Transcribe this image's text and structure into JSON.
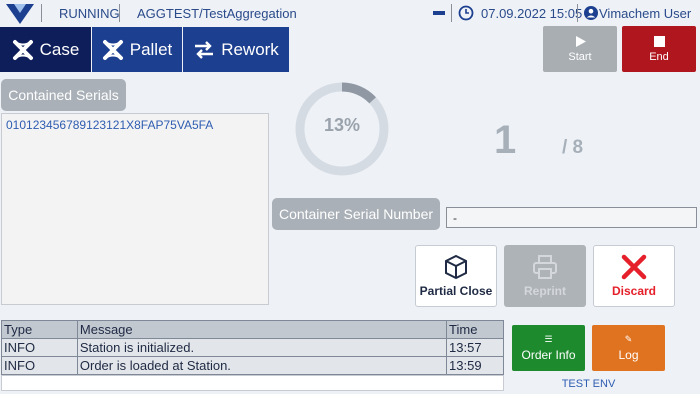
{
  "header": {
    "status": "RUNNING",
    "project": "AGGTEST/TestAggregation",
    "datetime": "07.09.2022 15:05",
    "user": "Vimachem User"
  },
  "modes": [
    {
      "label": "Case",
      "icon": "case-icon"
    },
    {
      "label": "Pallet",
      "icon": "pallet-icon"
    },
    {
      "label": "Rework",
      "icon": "swap-arrows-icon"
    }
  ],
  "controls": {
    "start": "Start",
    "end": "End"
  },
  "serials": {
    "title": "Contained Serials",
    "items": [
      "010123456789123121X8FAP75VA5FA"
    ]
  },
  "progress": {
    "percent": 13,
    "percent_label": "13%",
    "count": "1",
    "total": "/ 8"
  },
  "container": {
    "label": "Container Serial Number",
    "value": "-"
  },
  "actions": {
    "partial_close": "Partial Close",
    "reprint": "Reprint",
    "discard": "Discard"
  },
  "log": {
    "columns": [
      "Type",
      "Message",
      "Time"
    ],
    "rows": [
      {
        "type": "INFO",
        "message": "Station is initialized.",
        "time": "13:57"
      },
      {
        "type": "INFO",
        "message": "Order is loaded at Station.",
        "time": "13:59"
      }
    ]
  },
  "side": {
    "order_info": "Order Info",
    "log": "Log"
  },
  "env": "TEST ENV",
  "colors": {
    "primary": "#1d3f8f",
    "primary_active": "#0d1e5a",
    "end": "#b0161d",
    "start_disabled": "#a9aeb3",
    "order_info": "#1e8a2e",
    "log": "#e0731f",
    "discard_x": "#e5202a"
  }
}
